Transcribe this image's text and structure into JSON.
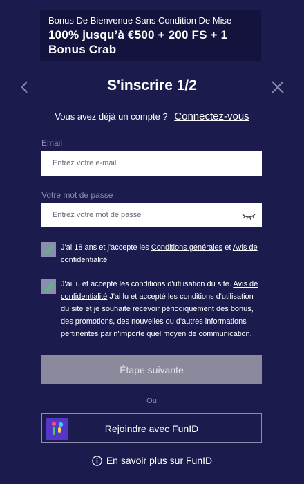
{
  "banner": {
    "line1": "Bonus De Bienvenue Sans Condition De Mise",
    "line2a": "100% jusqu’à €500 + 200 FS + 1",
    "line2b": "Bonus Crab"
  },
  "header": {
    "title": "S'inscrire 1/2",
    "back_icon": "chevron-left-icon",
    "close_icon": "close-icon"
  },
  "login": {
    "question": "Vous avez déjà un compte ?",
    "link": "Connectez-vous"
  },
  "email": {
    "label": "Email",
    "placeholder": "Entrez votre e-mail",
    "value": ""
  },
  "password": {
    "label": "Votre mot de passe",
    "placeholder": "Entrez votre mot de passe",
    "value": "",
    "toggle_icon": "eye-closed-icon"
  },
  "checkbox1": {
    "checked": true,
    "text_before": "J'ai 18 ans et j'accepte les ",
    "link1": "Conditions générales",
    "text_mid": " et ",
    "link2": "Avis de confidentialité"
  },
  "checkbox2": {
    "checked": true,
    "text_before": "J'ai lu et accepté les conditions d'utilisation du site. ",
    "link": "Avis de confidentialité",
    "text_after": " J'ai lu et accepté les conditions d'utilisation du site et je souhaite recevoir périodiquement des bonus, des promotions, des nouvelles ou d'autres informations pertinentes par n'importe quel moyen de communication."
  },
  "next_button": {
    "label": "Étape suivante"
  },
  "divider": {
    "label": "Ou"
  },
  "funid": {
    "label": "Rejoindre avec FunID",
    "icon": "funid-logo-icon"
  },
  "learn_more": {
    "label": "En savoir plus sur FunID",
    "icon": "info-icon"
  },
  "colors": {
    "background": "#1b1b4d",
    "banner": "#13133e",
    "checkbox": "#8c8cae",
    "check_mark": "#3ecf6a",
    "button_disabled": "#8a8a9c",
    "funid_purple": "#5436c9"
  }
}
